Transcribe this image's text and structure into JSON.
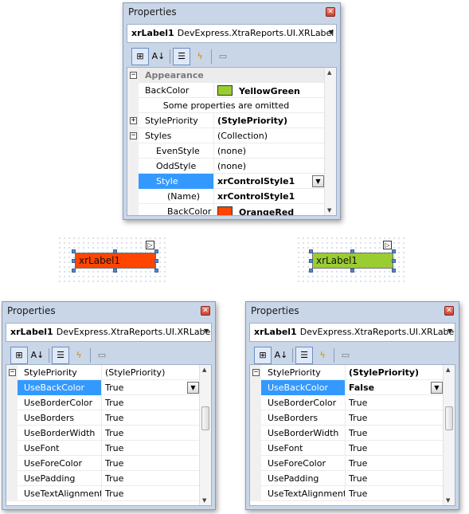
{
  "common": {
    "title": "Properties",
    "object_name": "xrLabel1",
    "object_type": "DevExpress.XtraReports.UI.XRLabel"
  },
  "top_panel": {
    "rows": [
      {
        "name": "Appearance",
        "value": "",
        "kind": "category",
        "expander": "−"
      },
      {
        "name": "BackColor",
        "value": "YellowGreen",
        "bold": true,
        "swatch": "#9acd32"
      },
      {
        "name": "",
        "value": "Some properties are omitted",
        "kind": "note"
      },
      {
        "name": "StylePriority",
        "value": "(StylePriority)",
        "bold": true,
        "expander": "+"
      },
      {
        "name": "Styles",
        "value": "(Collection)",
        "expander": "−"
      },
      {
        "name": "EvenStyle",
        "value": "(none)",
        "indent": 1
      },
      {
        "name": "OddStyle",
        "value": "(none)",
        "indent": 1
      },
      {
        "name": "Style",
        "value": "xrControlStyle1",
        "bold": true,
        "indent": 1,
        "expander": "−",
        "selected": true,
        "dropdown": true
      },
      {
        "name": "(Name)",
        "value": "xrControlStyle1",
        "bold": true,
        "indent": 2
      },
      {
        "name": "BackColor",
        "value": "OrangeRed",
        "bold": true,
        "indent": 2,
        "swatch": "#ff4500"
      }
    ]
  },
  "labels": {
    "left": {
      "text": "xrLabel1",
      "color": "#ff4500"
    },
    "right": {
      "text": "xrLabel1",
      "color": "#9acd32"
    }
  },
  "bottom_left": {
    "rows": [
      {
        "name": "StylePriority",
        "value": "(StylePriority)",
        "expander": "−"
      },
      {
        "name": "UseBackColor",
        "value": "True",
        "selected": true,
        "dropdown": true
      },
      {
        "name": "UseBorderColor",
        "value": "True"
      },
      {
        "name": "UseBorders",
        "value": "True"
      },
      {
        "name": "UseBorderWidth",
        "value": "True"
      },
      {
        "name": "UseFont",
        "value": "True"
      },
      {
        "name": "UseForeColor",
        "value": "True"
      },
      {
        "name": "UsePadding",
        "value": "True"
      },
      {
        "name": "UseTextAlignment",
        "value": "True"
      }
    ]
  },
  "bottom_right": {
    "rows": [
      {
        "name": "StylePriority",
        "value": "(StylePriority)",
        "bold": true,
        "expander": "−"
      },
      {
        "name": "UseBackColor",
        "value": "False",
        "bold": true,
        "selected": true,
        "dropdown": true
      },
      {
        "name": "UseBorderColor",
        "value": "True"
      },
      {
        "name": "UseBorders",
        "value": "True"
      },
      {
        "name": "UseBorderWidth",
        "value": "True"
      },
      {
        "name": "UseFont",
        "value": "True"
      },
      {
        "name": "UseForeColor",
        "value": "True"
      },
      {
        "name": "UsePadding",
        "value": "True"
      },
      {
        "name": "UseTextAlignment",
        "value": "True"
      }
    ]
  },
  "toolbar_icons": [
    "categorized-icon",
    "alphabetical-icon",
    "properties-icon",
    "events-icon",
    "property-pages-icon"
  ],
  "icons": {
    "close": "✕",
    "dropdown": "▼",
    "scroll_up": "▲",
    "scroll_down": "▼",
    "smart_tag": "▷",
    "categorized": "⊞",
    "alphabetical": "A↓",
    "properties": "☰",
    "events": "ϟ",
    "property_pages": "▭"
  }
}
